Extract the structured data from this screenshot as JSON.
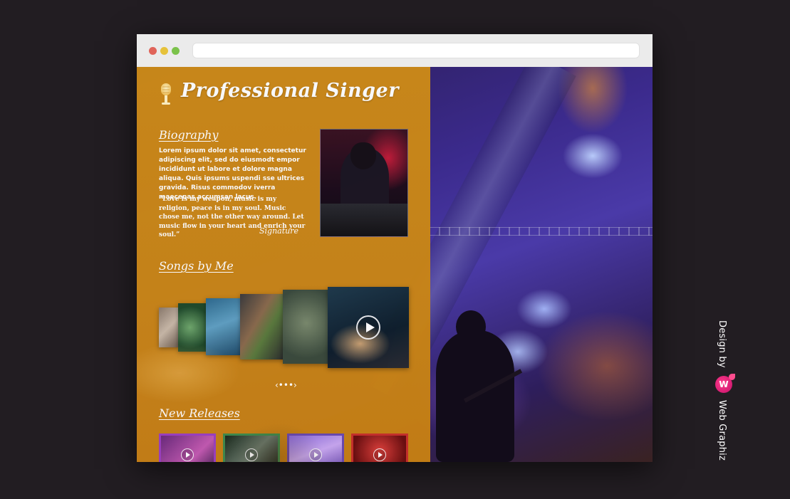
{
  "site": {
    "title": "Professional Singer"
  },
  "biography": {
    "heading": "Biography",
    "body": "Lorem ipsum dolor sit amet, consectetur adipiscing elit, sed do eiusmodt empor incididunt ut labore et dolore magna aliqua. Quis ipsums uspendi sse ultrices gravida. Risus commodov iverra maecenas accumsan lacus.",
    "quote": "“Love is my weapon, music is my religion, peace is in my soul. Music chose me, not the other way around. Let music flow in your heart and enrich your soul.”",
    "signature": "Signature"
  },
  "songs": {
    "heading": "Songs by Me"
  },
  "new_releases": {
    "heading": "New Releases"
  },
  "credit": {
    "prefix": "Design by",
    "brand": "Web Graphiz",
    "logo_letter": "W"
  },
  "colors": {
    "accent_orange": "#cc8a18",
    "brand_pink": "#e2187a",
    "background": "#221d22"
  }
}
